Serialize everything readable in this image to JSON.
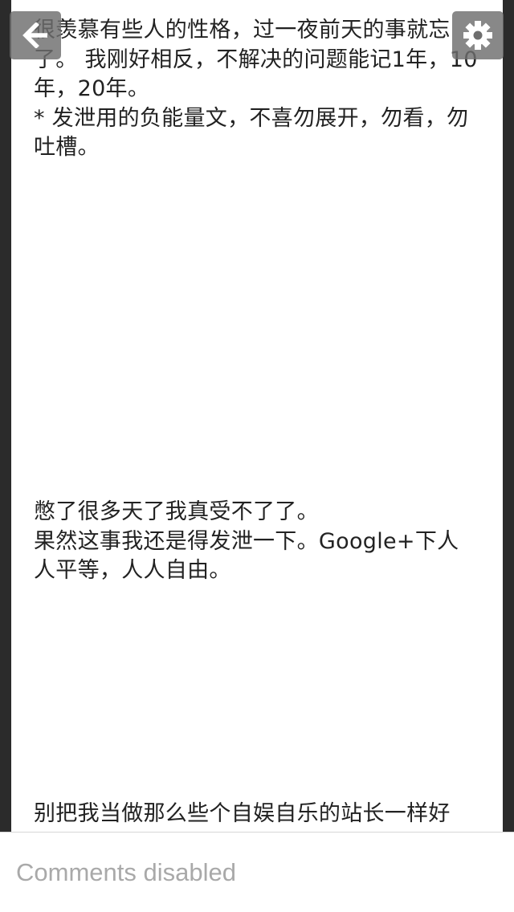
{
  "post": {
    "paragraph_1": "很羡慕有些人的性格，过一夜前天的事就忘了。 我刚好相反，不解决的问题能记1年，10年，20年。",
    "paragraph_1_note": "* 发泄用的负能量文，不喜勿展开，勿看，勿吐槽。",
    "paragraph_2": "憋了很多天了我真受不了了。",
    "paragraph_2_line2": "果然这事我还是得发泄一下。Google+下人人平等，人人自由。",
    "paragraph_3": "别把我当做那么些个自娱自乐的站长一样好"
  },
  "toolbar": {
    "back_icon": "back-arrow-icon",
    "settings_icon": "gear-icon"
  },
  "footer": {
    "comments_label": "Comments disabled"
  },
  "colors": {
    "page_background": "#2b2b2b",
    "content_background": "#ffffff",
    "text": "#222222",
    "muted_text": "#a9a9a9",
    "overlay_button": "#6e6e6e"
  }
}
